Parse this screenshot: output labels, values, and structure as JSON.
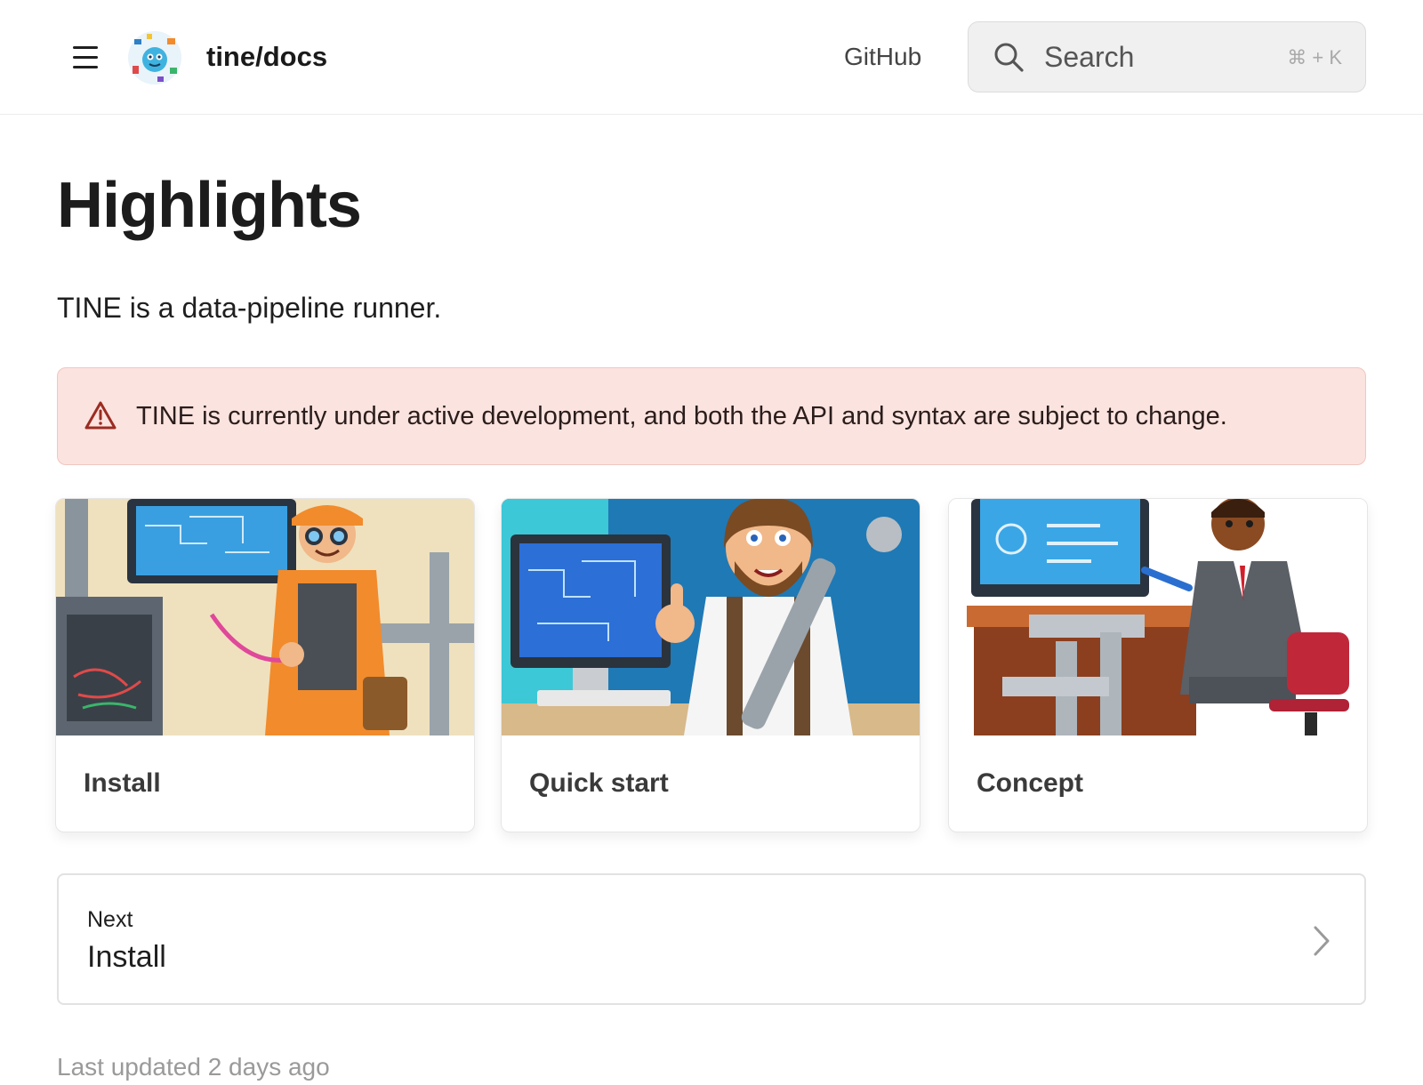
{
  "header": {
    "site_title": "tine/docs",
    "github_label": "GitHub",
    "search_placeholder": "Search",
    "search_shortcut": "⌘ + K"
  },
  "page": {
    "title": "Highlights",
    "intro": "TINE is a data-pipeline runner.",
    "warning": "TINE is currently under active development, and both the API and syntax are subject to change."
  },
  "cards": [
    {
      "label": "Install",
      "illustration": "plumber-with-wrench-and-server-rack"
    },
    {
      "label": "Quick start",
      "illustration": "plumber-thumbs-up-with-computer"
    },
    {
      "label": "Concept",
      "illustration": "businessman-at-desk-with-pipes"
    }
  ],
  "next": {
    "small_label": "Next",
    "title": "Install"
  },
  "footer": {
    "last_updated": "Last updated 2 days ago"
  },
  "colors": {
    "warning_bg": "#fbe3df",
    "warning_border": "#f1c7c0",
    "warning_icon": "#9b2c22"
  }
}
